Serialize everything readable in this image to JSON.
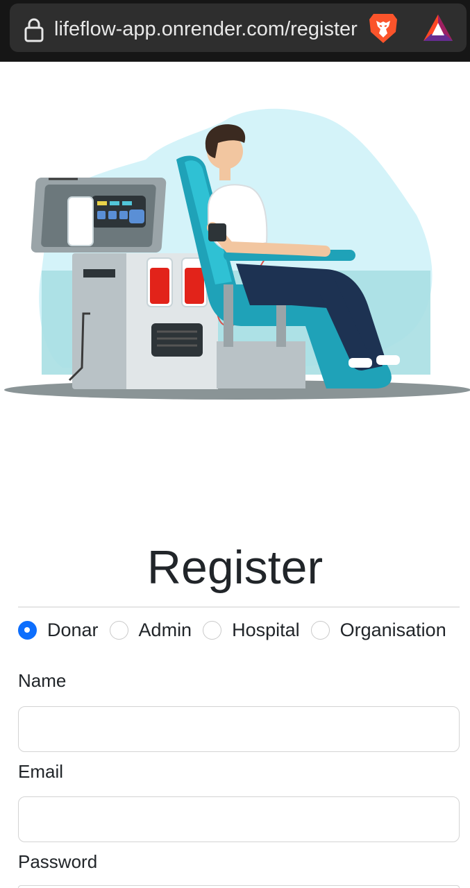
{
  "browser": {
    "url": "lifeflow-app.onrender.com/register",
    "icons": [
      "lock-icon",
      "brave-lion-icon",
      "bat-rewards-icon"
    ]
  },
  "hero": {
    "image": "blood-donation-illustration"
  },
  "form": {
    "title": "Register",
    "roles": [
      {
        "label": "Donar",
        "checked": true
      },
      {
        "label": "Admin",
        "checked": false
      },
      {
        "label": "Hospital",
        "checked": false
      },
      {
        "label": "Organisation",
        "checked": false
      }
    ],
    "fields": [
      {
        "label": "Name",
        "value": "",
        "placeholder": ""
      },
      {
        "label": "Email",
        "value": "",
        "placeholder": ""
      },
      {
        "label": "Password",
        "value": "",
        "placeholder": ""
      }
    ]
  },
  "colors": {
    "accent": "#0d6efd",
    "chrome": "#161616",
    "urlbar": "#2e2e2e",
    "text": "#212529"
  }
}
